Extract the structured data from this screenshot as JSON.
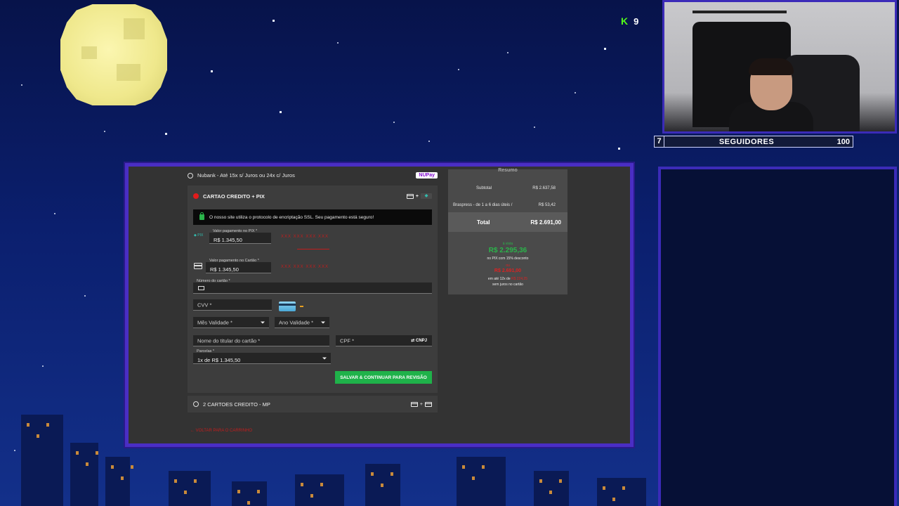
{
  "stream": {
    "kick_logo": "K",
    "kick_viewers": "9",
    "follower_goal": {
      "current": "7",
      "label": "SEGUIDORES",
      "target": "100"
    }
  },
  "checkout": {
    "nubank_option": "Nubank - Até 15x s/ Juros ou 24x c/ Juros",
    "nupay_badge": "NUPay",
    "method_title": "CARTAO CREDITO + PIX",
    "ssl_notice": "O nosso site utiliza o protocolo de encriptação SSL. Seu pagamento está seguro!",
    "pix_amount": {
      "label": "Valor pagamento no PIX *",
      "value": "R$ 1.345,50"
    },
    "card_amount": {
      "label": "Valor pagamento no Cartão *",
      "value": "R$ 1.345,50"
    },
    "card_number": {
      "label": "Número do cartão *",
      "value": ""
    },
    "cvv": {
      "placeholder": "CVV *"
    },
    "month": {
      "placeholder": "Mês Validade *"
    },
    "year": {
      "placeholder": "Ano Validade *"
    },
    "holder": {
      "placeholder": "Nome do titular do cartão *"
    },
    "cpf": {
      "placeholder": "CPF *",
      "toggle": "⇄ CNPJ"
    },
    "installments": {
      "label": "Parcelas *",
      "value": "1x de R$ 1.345,50"
    },
    "save_button": "SALVAR & CONTINUAR PARA REVISÃO",
    "two_cards_option": "2 CARTOES CREDITO - MP",
    "back_link": "← VOLTAR PARA O CARRINHO",
    "redacted": "XXX XXX XXX XXX"
  },
  "summary": {
    "title": "Resumo",
    "subtotal_label": "Subtotal",
    "subtotal_value": "R$ 2.637,58",
    "shipping_label": "Braspress - de 1 a 6 dias úteis /",
    "shipping_value": "R$ 53,42",
    "total_label": "Total",
    "total_value": "R$ 2.691,00",
    "pix_small": "à vista",
    "pix_price": "R$ 2.295,36",
    "pix_note": "no PIX com 15% desconto",
    "card_small": "ou",
    "card_price": "R$ 2.691,00",
    "installment_note": "em até 12x de",
    "installment_value": "R$ 224,25",
    "no_interest": "sem juros no cartão"
  },
  "colors": {
    "accent_green": "#1fb24a",
    "frame_purple": "#4a2ec4",
    "kick_green": "#53fc18"
  }
}
